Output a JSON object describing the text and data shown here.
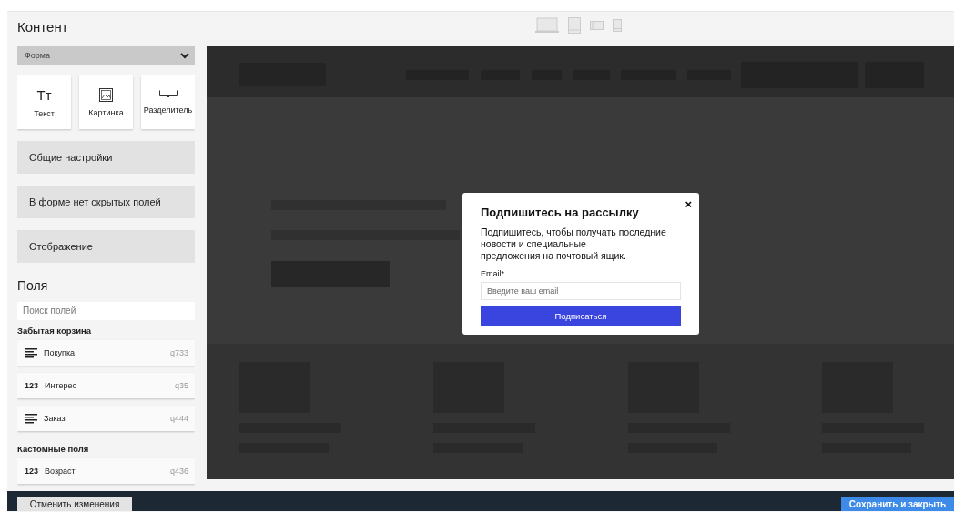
{
  "header": {
    "title": "Контент"
  },
  "panel": {
    "dropdown": "Форма",
    "tools": [
      {
        "kind": "text",
        "icon_text": "Тт",
        "label": "Текст"
      },
      {
        "kind": "image",
        "label": "Картинка"
      },
      {
        "kind": "divider",
        "label": "Разделитель"
      }
    ],
    "sections": [
      "Общие настройки",
      "В форме нет скрытых полей",
      "Отображение"
    ],
    "fields_title": "Поля",
    "search": {
      "placeholder": "Поиск полей"
    },
    "groups": [
      {
        "title": "Забытая корзина",
        "fields": [
          {
            "kind": "text",
            "label": "Покупка",
            "code": "q733"
          },
          {
            "kind": "number",
            "icon_text": "123",
            "label": "Интерес",
            "code": "q35"
          },
          {
            "kind": "text",
            "label": "Заказ",
            "code": "q444"
          }
        ]
      },
      {
        "title": "Кастомные поля",
        "fields": [
          {
            "kind": "number",
            "icon_text": "123",
            "label": "Возраст",
            "code": "q436"
          }
        ]
      }
    ]
  },
  "popup": {
    "title": "Подпишитесь на рассылку",
    "close": "×",
    "text": "Подпишитесь, чтобы получать последние\nновости и специальные\nпредложения на почтовый ящик.",
    "email_label": "Email*",
    "email_placeholder": "Введите ваш email",
    "button": "Подписаться"
  },
  "footer": {
    "cancel": "Отменить изменения",
    "save": "Сохранить и закрыть"
  }
}
